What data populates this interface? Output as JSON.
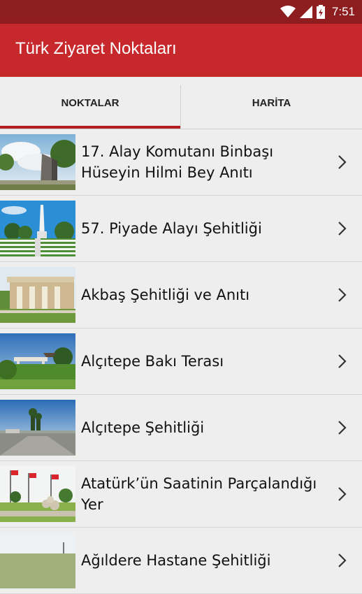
{
  "status_bar": {
    "time": "7:51"
  },
  "app_bar": {
    "title": "Türk Ziyaret Noktaları"
  },
  "tabs": [
    {
      "label": "NOKTALAR",
      "selected": true
    },
    {
      "label": "HARİTA",
      "selected": false
    }
  ],
  "places": [
    {
      "name": "17. Alay Komutanı Binbaşı Hüseyin Hilmi Bey Anıtı"
    },
    {
      "name": "57. Piyade Alayı Şehitliği"
    },
    {
      "name": "Akbaş Şehitliği ve Anıtı"
    },
    {
      "name": "Alçıtepe Bakı Terası"
    },
    {
      "name": "Alçıtepe Şehitliği"
    },
    {
      "name": "Atatürk’ün Saatinin Parçalandığı Yer"
    },
    {
      "name": "Ağıldere Hastane Şehitliği"
    }
  ],
  "colors": {
    "status_bar": "#8e1d1f",
    "app_bar": "#c6282b",
    "tab_indicator": "#b21e22"
  }
}
